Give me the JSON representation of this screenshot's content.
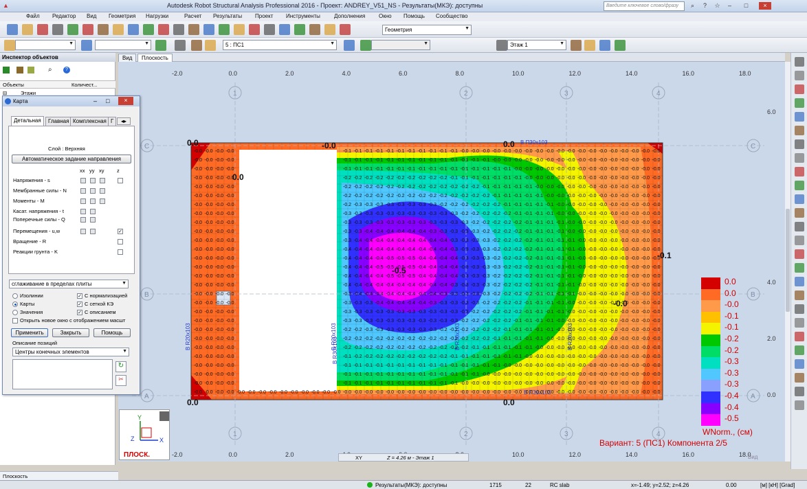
{
  "window": {
    "title": "Autodesk Robot Structural Analysis Professional 2016 - Проект: ANDREY_V51_NS - Результаты(МКЭ): доступны",
    "search_placeholder": "Введите ключевое слово/фразу"
  },
  "menu": [
    "Файл",
    "Редактор",
    "Вид",
    "Геометрия",
    "Нагрузки",
    "Расчет",
    "Результаты",
    "Проект",
    "Инструменты",
    "Дополнения",
    "Окно",
    "Помощь",
    "Сообщество"
  ],
  "toolbar": {
    "layout_combo": "Геометрия",
    "case_combo": "5 : ПС1",
    "storey_combo": "Этаж 1"
  },
  "inspector": {
    "title": "Инспектор объектов",
    "col_objects": "Объекты",
    "col_count": "Количест...",
    "tree_item": "Этажи"
  },
  "view_tabs": [
    "Вид",
    "Плоскость"
  ],
  "dialog": {
    "title": "Карта",
    "tabs": [
      "Детальная",
      "Главная",
      "Комплексная",
      "Г"
    ],
    "layer": "Слой : Верхняя",
    "auto_dir_button": "Автоматическое задание направления",
    "columns": [
      "xx",
      "yy",
      "xy",
      "z"
    ],
    "rows": [
      {
        "label": "Напряжения - s"
      },
      {
        "label": "Мембранные силы - N"
      },
      {
        "label": "Моменты - M"
      },
      {
        "label": "Касат. напряжения - t"
      },
      {
        "label": "Поперечные силы - Q"
      },
      {
        "label": "Перемещения - u,w"
      },
      {
        "label": "Вращение - R"
      },
      {
        "label": "Реакции грунта - K"
      }
    ],
    "smoothing": "сглаживание в пределах плиты",
    "radio_isolines": "Изолинии",
    "radio_maps": "Карты",
    "radio_values": "Значения",
    "chk_normalization": "С нормализацией",
    "chk_fe_grid": "С сеткой КЭ",
    "chk_description": "С описанием",
    "chk_new_window": "Открыть новое окно с отображением масшт",
    "btn_apply": "Применить",
    "btn_close": "Закрыть",
    "btn_help": "Помощь",
    "position_desc_label": "Описание позиций",
    "position_combo": "Центры конечных элементов"
  },
  "plot": {
    "x_ticks_top": [
      "-2.0",
      "0.0",
      "2.0",
      "4.0",
      "6.0",
      "8.0",
      "10.0",
      "12.0",
      "14.0",
      "16.0",
      "18.0"
    ],
    "x_ticks_bottom": [
      "-2.0",
      "0.0",
      "2.0",
      "4.0",
      "6.0",
      "8.0",
      "10.0",
      "12.0",
      "14.0",
      "16.0",
      "18.0"
    ],
    "y_ticks_right": [
      "6.0",
      "4.0",
      "2.0",
      "0.0"
    ],
    "col_axes": [
      "1",
      "2",
      "3",
      "4"
    ],
    "row_axes": [
      "C",
      "B",
      "A"
    ],
    "beam_labels": [
      "В П30x103",
      "В R20x103",
      "В R30x103",
      "В R20x103",
      "В R30x103",
      "В R20x103",
      "В П30x103"
    ],
    "big_labels": [
      "0.0",
      "0.0",
      "-0.0",
      "-0.5",
      "-0.0",
      "-0.1",
      "0.0",
      "0.0",
      "0.0"
    ],
    "axis_label_xy": "XY",
    "z_info": "Z = 4.26 м - Этаж 1",
    "view_label": "ПЛОСК.",
    "small_view_label": "Вид"
  },
  "legend": {
    "values": [
      "0.0",
      "0.0",
      "-0.0",
      "-0.1",
      "-0.1",
      "-0.2",
      "-0.2",
      "-0.3",
      "-0.3",
      "-0.3",
      "-0.4",
      "-0.4",
      "-0.5"
    ],
    "colors": [
      "#d40000",
      "#ff6a24",
      "#ff9a4a",
      "#ffc000",
      "#f4f400",
      "#00c800",
      "#00dd66",
      "#00e0c0",
      "#50c8ff",
      "#8aa0ff",
      "#3030ff",
      "#8800ff",
      "#ff00ff"
    ],
    "unit": "WNorm., (см)",
    "variant": "Вариант: 5 (ПС1) Компонента 2/5"
  },
  "status": {
    "bottom_tab": "Плоскость",
    "results": "Результаты(МКЭ): доступны",
    "n1": "1715",
    "n2": "22",
    "section": "RC slab",
    "coords": "x=-1.49; y=2.52; z=4.26",
    "value": "0.00",
    "units": "[м] [кН] [Grad]"
  }
}
